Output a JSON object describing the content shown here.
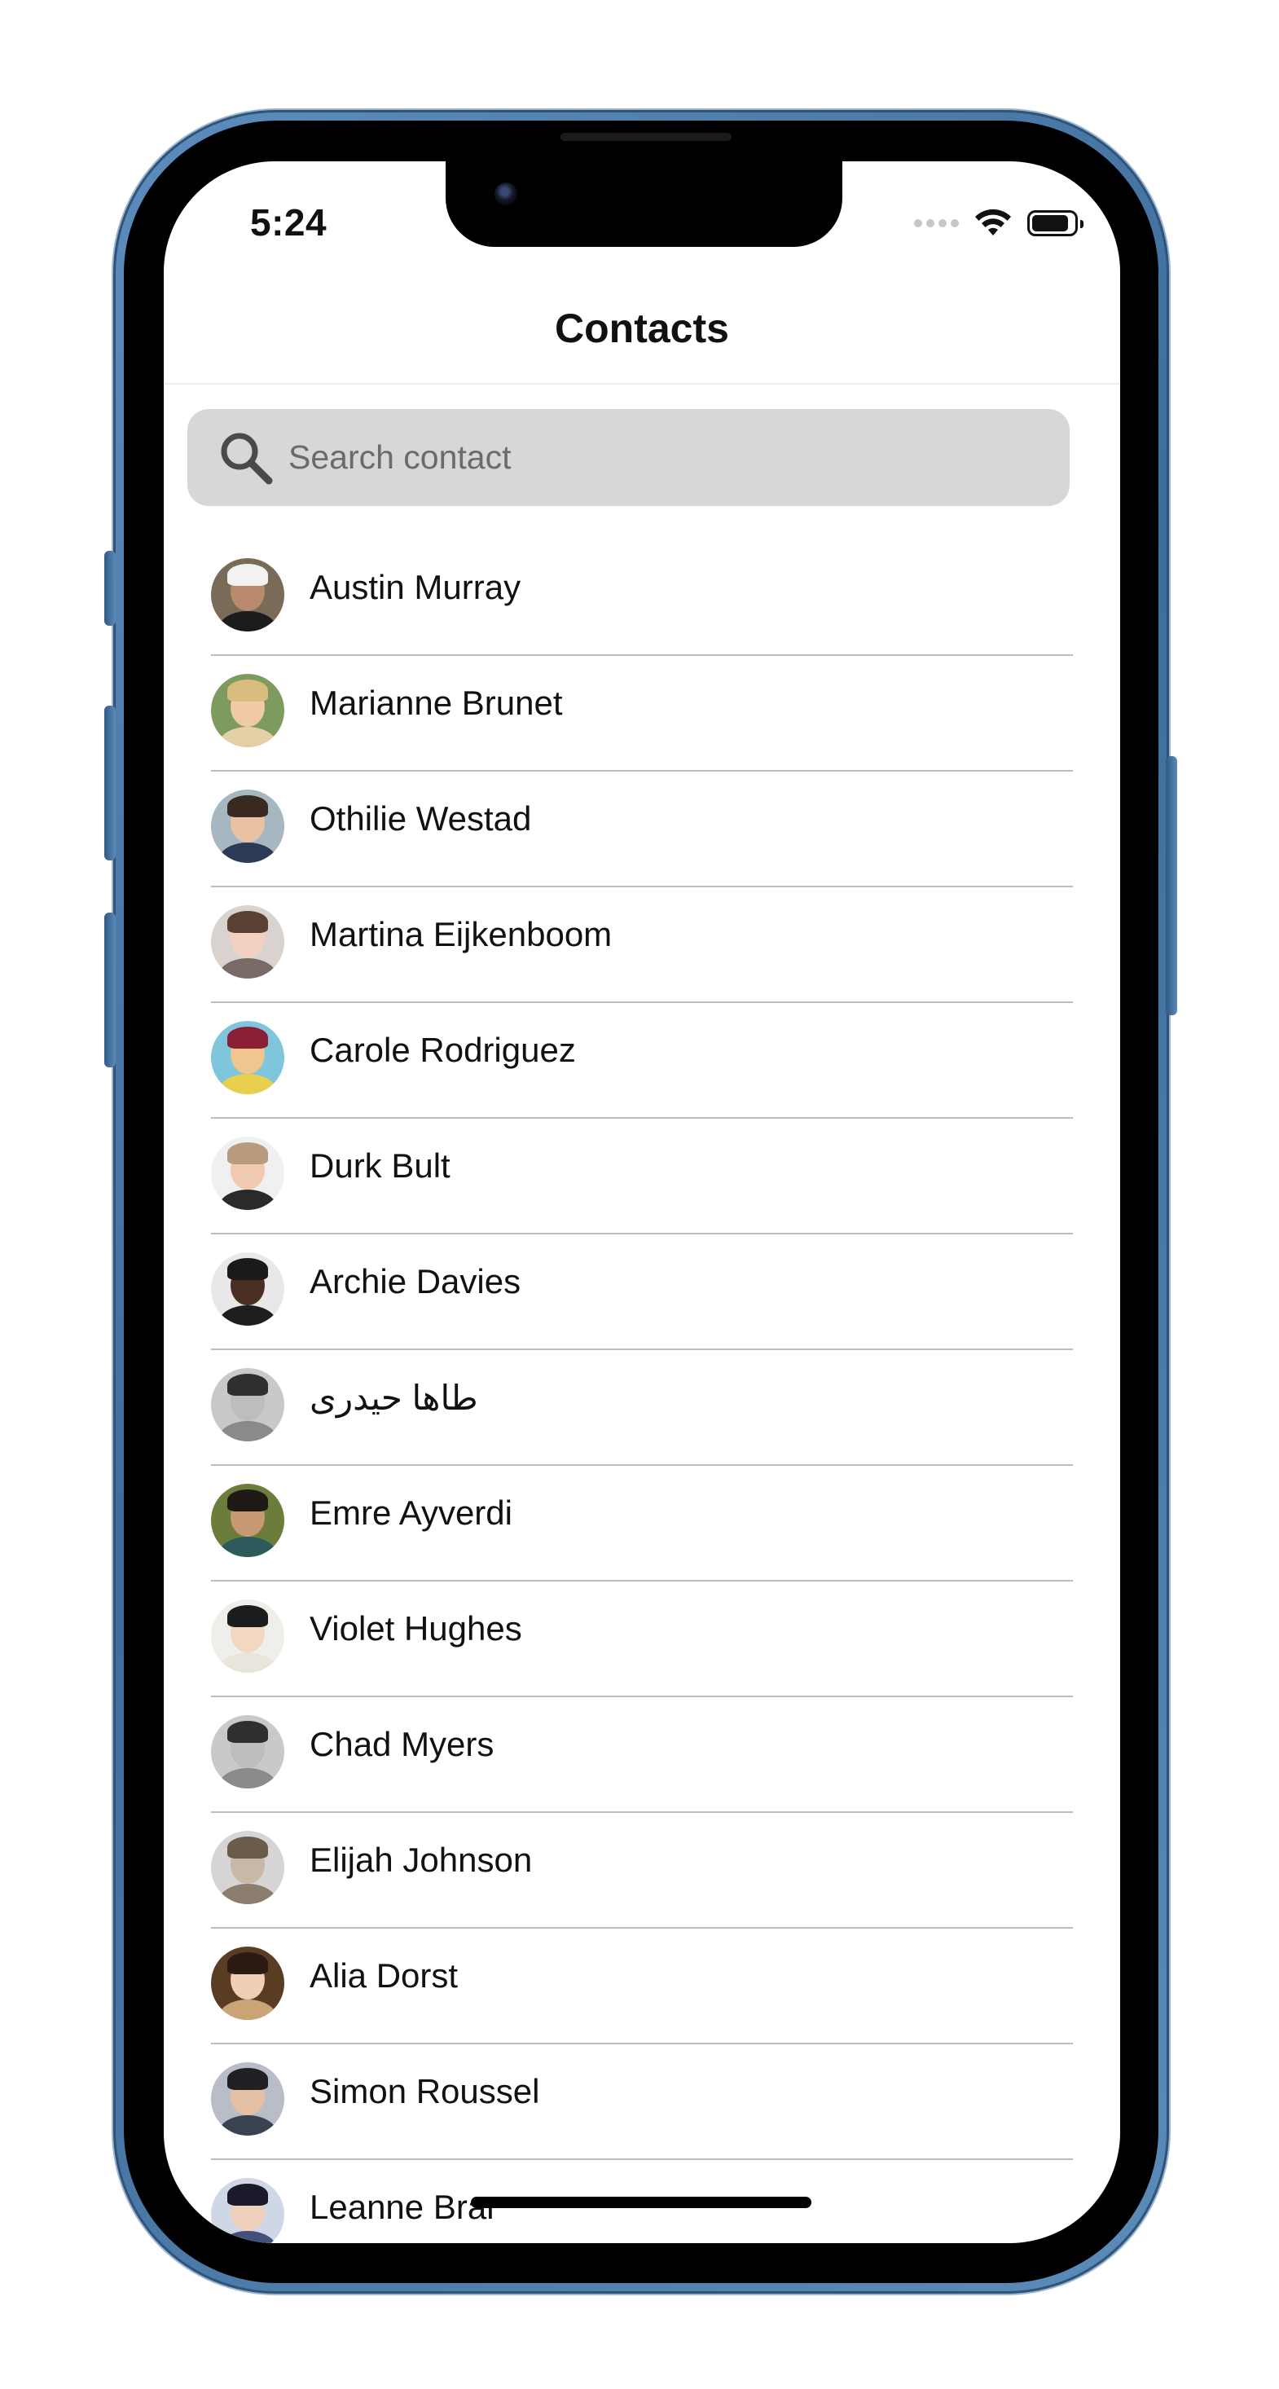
{
  "status_bar": {
    "time": "5:24",
    "battery_level": 0.9
  },
  "nav": {
    "title": "Contacts"
  },
  "search": {
    "placeholder": "Search contact",
    "value": ""
  },
  "icons": {
    "search": "search-icon",
    "wifi": "wifi-icon",
    "battery": "battery-icon",
    "signal": "cellular-signal-icon"
  },
  "colors": {
    "search_background": "#d7d7d7",
    "divider": "#bdbdbd",
    "frame": "#4a7aaa"
  },
  "contacts": [
    {
      "name": "Austin Murray",
      "avatar": {
        "bg": "#7a6a58",
        "skin": "#b98a6c",
        "hair": "#f2f2f2",
        "shirt": "#1c1c1c"
      }
    },
    {
      "name": "Marianne Brunet",
      "avatar": {
        "bg": "#7d9b5e",
        "skin": "#f0c9a6",
        "hair": "#d9bd7e",
        "shirt": "#e4cfa7"
      }
    },
    {
      "name": "Othilie Westad",
      "avatar": {
        "bg": "#a7b7c1",
        "skin": "#e9c2a3",
        "hair": "#3a2a22",
        "shirt": "#2b3b55"
      }
    },
    {
      "name": "Martina Eijkenboom",
      "avatar": {
        "bg": "#d9d3cf",
        "skin": "#f1d2c0",
        "hair": "#5a3f33",
        "shirt": "#7a6a66"
      }
    },
    {
      "name": "Carole Rodriguez",
      "avatar": {
        "bg": "#7fc6dd",
        "skin": "#f0c68e",
        "hair": "#8b1f36",
        "shirt": "#e8d04d"
      }
    },
    {
      "name": "Durk Bult",
      "avatar": {
        "bg": "#eef0f2",
        "skin": "#f1c8b0",
        "hair": "#b99a7d",
        "shirt": "#2a2a2a"
      }
    },
    {
      "name": "Archie Davies",
      "avatar": {
        "bg": "#e8e8e8",
        "skin": "#4a3023",
        "hair": "#1a1a1a",
        "shirt": "#1e1e1e"
      }
    },
    {
      "name": "طاها حیدری",
      "avatar": {
        "bg": "#c9c9c9",
        "skin": "#bdbdbd",
        "hair": "#2f2f2f",
        "shirt": "#8a8a8a"
      }
    },
    {
      "name": "Emre Ayverdi",
      "avatar": {
        "bg": "#6c7c3a",
        "skin": "#c89a74",
        "hair": "#1f1a16",
        "shirt": "#2f5a5c"
      }
    },
    {
      "name": "Violet Hughes",
      "avatar": {
        "bg": "#eeeeea",
        "skin": "#f2d7c2",
        "hair": "#1c1c1c",
        "shirt": "#e9e4dc"
      }
    },
    {
      "name": "Chad Myers",
      "avatar": {
        "bg": "#c9c9c9",
        "skin": "#bdbdbd",
        "hair": "#2f2f2f",
        "shirt": "#8a8a8a"
      }
    },
    {
      "name": "Elijah Johnson",
      "avatar": {
        "bg": "#d5d5d5",
        "skin": "#c8b8a8",
        "hair": "#6b5b4a",
        "shirt": "#8c7d6e"
      }
    },
    {
      "name": "Alia Dorst",
      "avatar": {
        "bg": "#5a3c22",
        "skin": "#f1cfb4",
        "hair": "#2a1c14",
        "shirt": "#c9a576"
      }
    },
    {
      "name": "Simon Roussel",
      "avatar": {
        "bg": "#b8bdc6",
        "skin": "#e6c0a5",
        "hair": "#1f1f24",
        "shirt": "#3b4252"
      }
    },
    {
      "name": "Leanne Brar",
      "avatar": {
        "bg": "#cfd6e6",
        "skin": "#f0d0bb",
        "hair": "#1a1a2a",
        "shirt": "#44507a"
      }
    }
  ]
}
